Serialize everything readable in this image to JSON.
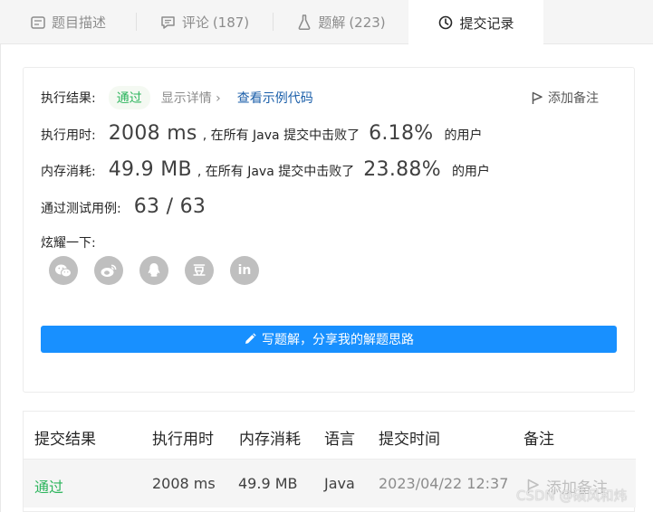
{
  "tabs": [
    {
      "label": "题目描述",
      "count": "",
      "icon": "description-icon"
    },
    {
      "label": "评论",
      "count": "(187)",
      "icon": "comment-icon"
    },
    {
      "label": "题解",
      "count": "(223)",
      "icon": "flask-icon"
    },
    {
      "label": "提交记录",
      "count": "",
      "icon": "clock-icon"
    }
  ],
  "result": {
    "label": "执行结果:",
    "status": "通过",
    "detail_link": "显示详情 ›",
    "code_link": "查看示例代码",
    "add_note": "添加备注"
  },
  "runtime": {
    "label": "执行用时:",
    "value": "2008 ms",
    "middle": ", 在所有 Java 提交中击败了",
    "percent": "6.18%",
    "suffix": "的用户"
  },
  "memory": {
    "label": "内存消耗:",
    "value": "49.9 MB",
    "middle": ", 在所有 Java 提交中击败了",
    "percent": "23.88%",
    "suffix": "的用户"
  },
  "tests": {
    "label": "通过测试用例:",
    "value": "63 / 63"
  },
  "share": {
    "label": "炫耀一下:",
    "items": [
      "wechat-icon",
      "weibo-icon",
      "qq-icon",
      "douban-icon",
      "linkedin-icon"
    ],
    "douban_glyph": "豆",
    "linkedin_glyph": "in"
  },
  "write_button": "写题解，分享我的解题思路",
  "table": {
    "headers": [
      "提交结果",
      "执行用时",
      "内存消耗",
      "语言",
      "提交时间",
      "备注"
    ],
    "rows": [
      {
        "result": "通过",
        "runtime": "2008 ms",
        "memory": "49.9 MB",
        "language": "Java",
        "time": "2023/04/22 12:37",
        "note": "添加备注"
      }
    ]
  },
  "watermark": "CSDN @硕风和炜",
  "colors": {
    "accent": "#1890ff",
    "success": "#2db55d",
    "link": "#1a5ea9"
  }
}
